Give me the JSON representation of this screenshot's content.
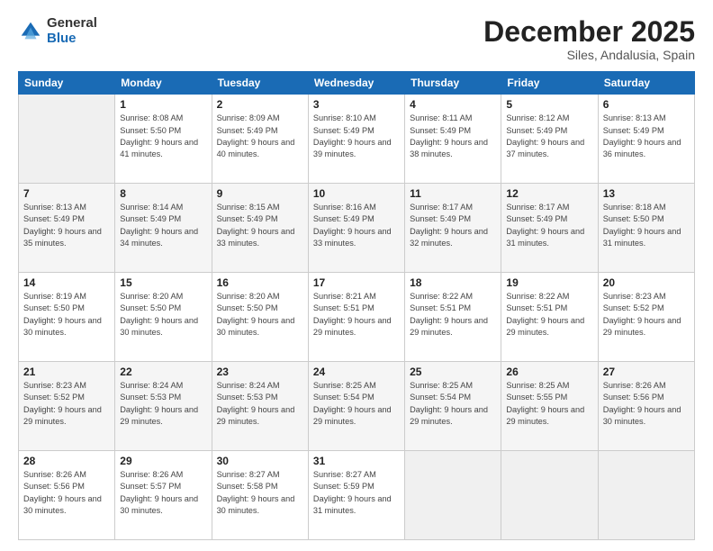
{
  "logo": {
    "general": "General",
    "blue": "Blue"
  },
  "title": "December 2025",
  "subtitle": "Siles, Andalusia, Spain",
  "days_header": [
    "Sunday",
    "Monday",
    "Tuesday",
    "Wednesday",
    "Thursday",
    "Friday",
    "Saturday"
  ],
  "weeks": [
    [
      {
        "day": "",
        "sunrise": "",
        "sunset": "",
        "daylight": "",
        "empty": true
      },
      {
        "day": "1",
        "sunrise": "Sunrise: 8:08 AM",
        "sunset": "Sunset: 5:50 PM",
        "daylight": "Daylight: 9 hours and 41 minutes."
      },
      {
        "day": "2",
        "sunrise": "Sunrise: 8:09 AM",
        "sunset": "Sunset: 5:49 PM",
        "daylight": "Daylight: 9 hours and 40 minutes."
      },
      {
        "day": "3",
        "sunrise": "Sunrise: 8:10 AM",
        "sunset": "Sunset: 5:49 PM",
        "daylight": "Daylight: 9 hours and 39 minutes."
      },
      {
        "day": "4",
        "sunrise": "Sunrise: 8:11 AM",
        "sunset": "Sunset: 5:49 PM",
        "daylight": "Daylight: 9 hours and 38 minutes."
      },
      {
        "day": "5",
        "sunrise": "Sunrise: 8:12 AM",
        "sunset": "Sunset: 5:49 PM",
        "daylight": "Daylight: 9 hours and 37 minutes."
      },
      {
        "day": "6",
        "sunrise": "Sunrise: 8:13 AM",
        "sunset": "Sunset: 5:49 PM",
        "daylight": "Daylight: 9 hours and 36 minutes."
      }
    ],
    [
      {
        "day": "7",
        "sunrise": "Sunrise: 8:13 AM",
        "sunset": "Sunset: 5:49 PM",
        "daylight": "Daylight: 9 hours and 35 minutes."
      },
      {
        "day": "8",
        "sunrise": "Sunrise: 8:14 AM",
        "sunset": "Sunset: 5:49 PM",
        "daylight": "Daylight: 9 hours and 34 minutes."
      },
      {
        "day": "9",
        "sunrise": "Sunrise: 8:15 AM",
        "sunset": "Sunset: 5:49 PM",
        "daylight": "Daylight: 9 hours and 33 minutes."
      },
      {
        "day": "10",
        "sunrise": "Sunrise: 8:16 AM",
        "sunset": "Sunset: 5:49 PM",
        "daylight": "Daylight: 9 hours and 33 minutes."
      },
      {
        "day": "11",
        "sunrise": "Sunrise: 8:17 AM",
        "sunset": "Sunset: 5:49 PM",
        "daylight": "Daylight: 9 hours and 32 minutes."
      },
      {
        "day": "12",
        "sunrise": "Sunrise: 8:17 AM",
        "sunset": "Sunset: 5:49 PM",
        "daylight": "Daylight: 9 hours and 31 minutes."
      },
      {
        "day": "13",
        "sunrise": "Sunrise: 8:18 AM",
        "sunset": "Sunset: 5:50 PM",
        "daylight": "Daylight: 9 hours and 31 minutes."
      }
    ],
    [
      {
        "day": "14",
        "sunrise": "Sunrise: 8:19 AM",
        "sunset": "Sunset: 5:50 PM",
        "daylight": "Daylight: 9 hours and 30 minutes."
      },
      {
        "day": "15",
        "sunrise": "Sunrise: 8:20 AM",
        "sunset": "Sunset: 5:50 PM",
        "daylight": "Daylight: 9 hours and 30 minutes."
      },
      {
        "day": "16",
        "sunrise": "Sunrise: 8:20 AM",
        "sunset": "Sunset: 5:50 PM",
        "daylight": "Daylight: 9 hours and 30 minutes."
      },
      {
        "day": "17",
        "sunrise": "Sunrise: 8:21 AM",
        "sunset": "Sunset: 5:51 PM",
        "daylight": "Daylight: 9 hours and 29 minutes."
      },
      {
        "day": "18",
        "sunrise": "Sunrise: 8:22 AM",
        "sunset": "Sunset: 5:51 PM",
        "daylight": "Daylight: 9 hours and 29 minutes."
      },
      {
        "day": "19",
        "sunrise": "Sunrise: 8:22 AM",
        "sunset": "Sunset: 5:51 PM",
        "daylight": "Daylight: 9 hours and 29 minutes."
      },
      {
        "day": "20",
        "sunrise": "Sunrise: 8:23 AM",
        "sunset": "Sunset: 5:52 PM",
        "daylight": "Daylight: 9 hours and 29 minutes."
      }
    ],
    [
      {
        "day": "21",
        "sunrise": "Sunrise: 8:23 AM",
        "sunset": "Sunset: 5:52 PM",
        "daylight": "Daylight: 9 hours and 29 minutes."
      },
      {
        "day": "22",
        "sunrise": "Sunrise: 8:24 AM",
        "sunset": "Sunset: 5:53 PM",
        "daylight": "Daylight: 9 hours and 29 minutes."
      },
      {
        "day": "23",
        "sunrise": "Sunrise: 8:24 AM",
        "sunset": "Sunset: 5:53 PM",
        "daylight": "Daylight: 9 hours and 29 minutes."
      },
      {
        "day": "24",
        "sunrise": "Sunrise: 8:25 AM",
        "sunset": "Sunset: 5:54 PM",
        "daylight": "Daylight: 9 hours and 29 minutes."
      },
      {
        "day": "25",
        "sunrise": "Sunrise: 8:25 AM",
        "sunset": "Sunset: 5:54 PM",
        "daylight": "Daylight: 9 hours and 29 minutes."
      },
      {
        "day": "26",
        "sunrise": "Sunrise: 8:25 AM",
        "sunset": "Sunset: 5:55 PM",
        "daylight": "Daylight: 9 hours and 29 minutes."
      },
      {
        "day": "27",
        "sunrise": "Sunrise: 8:26 AM",
        "sunset": "Sunset: 5:56 PM",
        "daylight": "Daylight: 9 hours and 30 minutes."
      }
    ],
    [
      {
        "day": "28",
        "sunrise": "Sunrise: 8:26 AM",
        "sunset": "Sunset: 5:56 PM",
        "daylight": "Daylight: 9 hours and 30 minutes."
      },
      {
        "day": "29",
        "sunrise": "Sunrise: 8:26 AM",
        "sunset": "Sunset: 5:57 PM",
        "daylight": "Daylight: 9 hours and 30 minutes."
      },
      {
        "day": "30",
        "sunrise": "Sunrise: 8:27 AM",
        "sunset": "Sunset: 5:58 PM",
        "daylight": "Daylight: 9 hours and 30 minutes."
      },
      {
        "day": "31",
        "sunrise": "Sunrise: 8:27 AM",
        "sunset": "Sunset: 5:59 PM",
        "daylight": "Daylight: 9 hours and 31 minutes."
      },
      {
        "day": "",
        "sunrise": "",
        "sunset": "",
        "daylight": "",
        "empty": true
      },
      {
        "day": "",
        "sunrise": "",
        "sunset": "",
        "daylight": "",
        "empty": true
      },
      {
        "day": "",
        "sunrise": "",
        "sunset": "",
        "daylight": "",
        "empty": true
      }
    ]
  ]
}
